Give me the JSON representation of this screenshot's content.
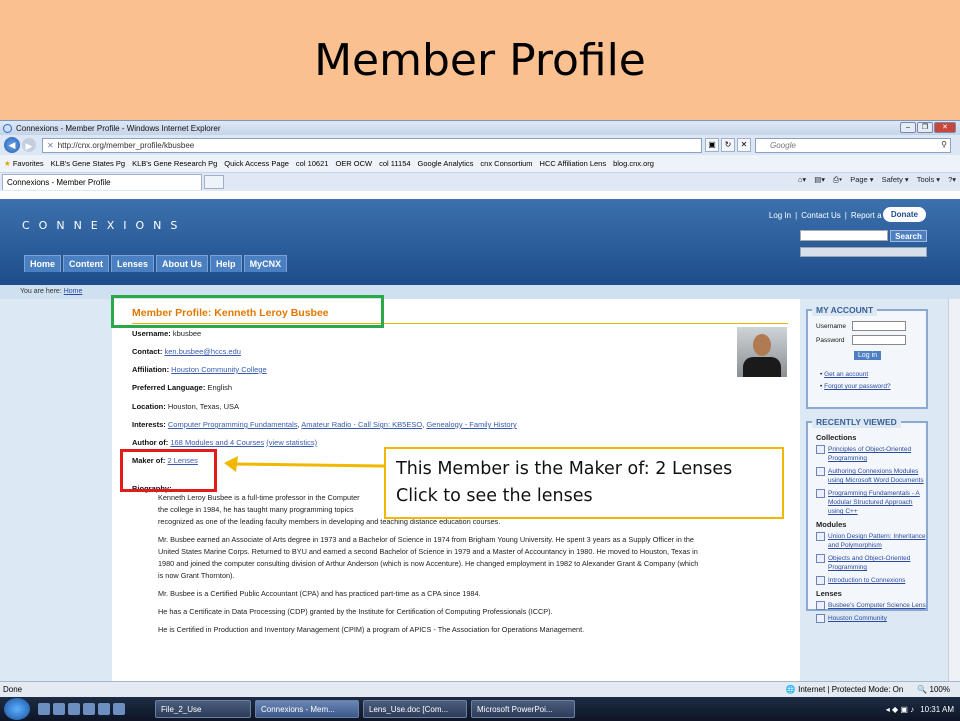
{
  "slide": {
    "title": "Member Profile"
  },
  "window": {
    "title": "Connexions - Member Profile - Windows Internet Explorer",
    "controls": [
      "–",
      "❐",
      "✕"
    ]
  },
  "addressbar": {
    "url": "http://cnx.org/member_profile/kbusbee",
    "search_placeholder": "Google"
  },
  "favorites": [
    "Favorites",
    "KLB's Gene States Pg",
    "KLB's Gene Research Pg",
    "Quick Access Page",
    "col 10621",
    "OER OCW",
    "col 11154",
    "Google Analytics",
    "cnx Consortium",
    "HCC Affiliation Lens",
    "blog.cnx.org"
  ],
  "tab": {
    "label": "Connexions - Member Profile"
  },
  "commandbar": [
    "Page ▾",
    "Safety ▾",
    "Tools ▾"
  ],
  "site": {
    "logo": "CONNEXIONS",
    "toplinks": [
      "Log In",
      "|",
      "Contact Us",
      "|",
      "Report a Bug"
    ],
    "donate": "Donate",
    "search_button": "Search",
    "nav": [
      "Home",
      "Content",
      "Lenses",
      "About Us",
      "Help",
      "MyCNX"
    ],
    "breadcrumb_prefix": "You are here:",
    "breadcrumb_link": "Home"
  },
  "profile": {
    "heading": "Member Profile: Kenneth Leroy Busbee",
    "username_label": "Username:",
    "username": "kbusbee",
    "contact_label": "Contact:",
    "contact": "ken.busbee@hccs.edu",
    "affiliation_label": "Affiliation:",
    "affiliation": "Houston Community College",
    "language_label": "Preferred Language:",
    "language": "English",
    "location_label": "Location:",
    "location": "Houston, Texas, USA",
    "interests_label": "Interests:",
    "interests": [
      "Computer Programming Fundamentals",
      "Amateur Radio - Call Sign: KB5ESO",
      "Genealogy - Family History"
    ],
    "author_label": "Author of:",
    "author": "168 Modules and 4 Courses",
    "author_stats": "(view statistics)",
    "maker_label": "Maker of:",
    "maker": "2 Lenses",
    "bio_label": "Biography:",
    "bio": [
      "Kenneth Leroy Busbee is a full-time professor in the Computer",
      "the college in 1984, he has taught many programming topics",
      "recognized as one of the leading faculty members in developing and teaching distance education courses.",
      "Mr. Busbee earned an Associate of Arts degree in 1973 and a Bachelor of Science in 1974 from Brigham Young University. He spent 3 years as a Supply Officer in the",
      "United States Marine Corps. Returned to BYU and earned a second Bachelor of Science in 1979 and a Master of Accountancy in 1980. He moved to Houston, Texas in",
      "1980 and joined the computer consulting division of Arthur Anderson (which is now Accenture). He changed employment in 1982 to Alexander Grant & Company (which",
      "is now Grant Thornton).",
      "Mr. Busbee is a Certified Public Accountant (CPA) and has practiced part-time as a CPA since 1984.",
      "He has a Certificate in Data Processing (CDP) granted by the Institute for Certification of Computing Professionals (ICCP).",
      "He is Certified in Production and Inventory Management (CPIM) a program of APICS - The Association for Operations Management."
    ]
  },
  "account": {
    "title": "MY ACCOUNT",
    "username_label": "Username",
    "password_label": "Password",
    "login": "Log in",
    "links": [
      "Get an account",
      "Forgot your password?"
    ]
  },
  "recent": {
    "title": "RECENTLY VIEWED",
    "collections_label": "Collections",
    "collections": [
      "Principles of Object-Oriented Programming",
      "Authoring Connexions Modules using Microsoft Word Documents",
      "Programming Fundamentals - A Modular Structured Approach using C++"
    ],
    "modules_label": "Modules",
    "modules": [
      "Union Design Pattern: Inheritance and Polymorphism",
      "Objects and Object-Oriented Programming",
      "Introduction to Connexions"
    ],
    "lenses_label": "Lenses",
    "lenses": [
      "Busbee's Computer Science Lens",
      "Houston Community"
    ]
  },
  "status": {
    "left": "Done",
    "zone": "Internet | Protected Mode: On",
    "zoom": "100%"
  },
  "taskbar": {
    "tasks": [
      "File_2_Use",
      "Connexions - Mem...",
      "Lens_Use.doc [Com...",
      "Microsoft PowerPoi..."
    ],
    "time": "10:31 AM"
  },
  "callout": {
    "line1": "This Member is the Maker of: 2 Lenses",
    "line2": "Click to see the lenses"
  },
  "colors": {
    "slide_bg": "#fac090",
    "accent_orange": "#e07800",
    "green_box": "#2aa84a",
    "red_box": "#e21b1b",
    "callout_border": "#f0b800"
  }
}
